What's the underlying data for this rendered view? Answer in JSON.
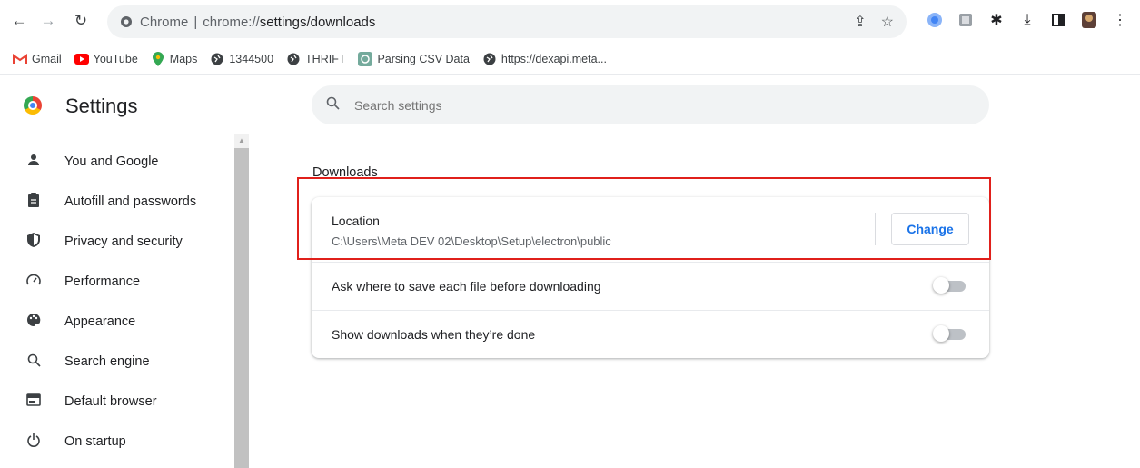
{
  "browser": {
    "omnibox": {
      "prefix": "Chrome",
      "separator": "|",
      "url_host": "chrome://",
      "url_path": "settings/downloads"
    },
    "bookmarks": [
      {
        "label": "Gmail",
        "icon": "gmail-icon"
      },
      {
        "label": "YouTube",
        "icon": "youtube-icon"
      },
      {
        "label": "Maps",
        "icon": "maps-icon"
      },
      {
        "label": "1344500",
        "icon": "globe-icon"
      },
      {
        "label": "THRIFT",
        "icon": "globe-icon"
      },
      {
        "label": "Parsing CSV Data",
        "icon": "chatgpt-icon"
      },
      {
        "label": "https://dexapi.meta...",
        "icon": "globe-icon"
      }
    ]
  },
  "header": {
    "title": "Settings",
    "search_placeholder": "Search settings"
  },
  "sidebar": {
    "items": [
      {
        "label": "You and Google",
        "icon": "person-icon"
      },
      {
        "label": "Autofill and passwords",
        "icon": "clipboard-icon"
      },
      {
        "label": "Privacy and security",
        "icon": "shield-icon"
      },
      {
        "label": "Performance",
        "icon": "speedometer-icon"
      },
      {
        "label": "Appearance",
        "icon": "palette-icon"
      },
      {
        "label": "Search engine",
        "icon": "search-icon"
      },
      {
        "label": "Default browser",
        "icon": "browser-window-icon"
      },
      {
        "label": "On startup",
        "icon": "power-icon"
      }
    ]
  },
  "main": {
    "section_title": "Downloads",
    "location": {
      "label": "Location",
      "path": "C:\\Users\\Meta DEV 02\\Desktop\\Setup\\electron\\public",
      "button": "Change"
    },
    "options": [
      {
        "label": "Ask where to save each file before downloading",
        "enabled": false
      },
      {
        "label": "Show downloads when they’re done",
        "enabled": false
      }
    ]
  },
  "colors": {
    "accent": "#1a73e8",
    "highlight_box": "#e0201b"
  }
}
